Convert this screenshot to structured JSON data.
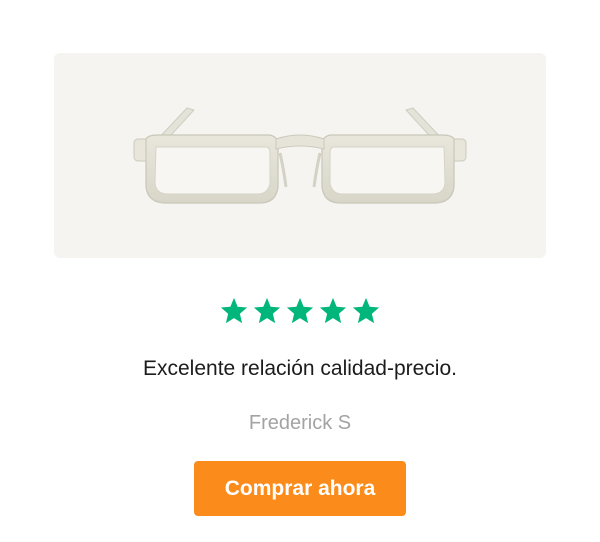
{
  "product": {
    "image_label": "clear-rectangular-eyeglasses"
  },
  "review": {
    "rating": 5,
    "rating_max": 5,
    "text": "Excelente relación calidad-precio.",
    "author": "Frederick S"
  },
  "cta": {
    "label": "Comprar ahora"
  },
  "colors": {
    "star": "#00b67a",
    "button": "#fb8c1b",
    "image_background": "#f5f4f1",
    "author_text": "#a3a3a3"
  }
}
